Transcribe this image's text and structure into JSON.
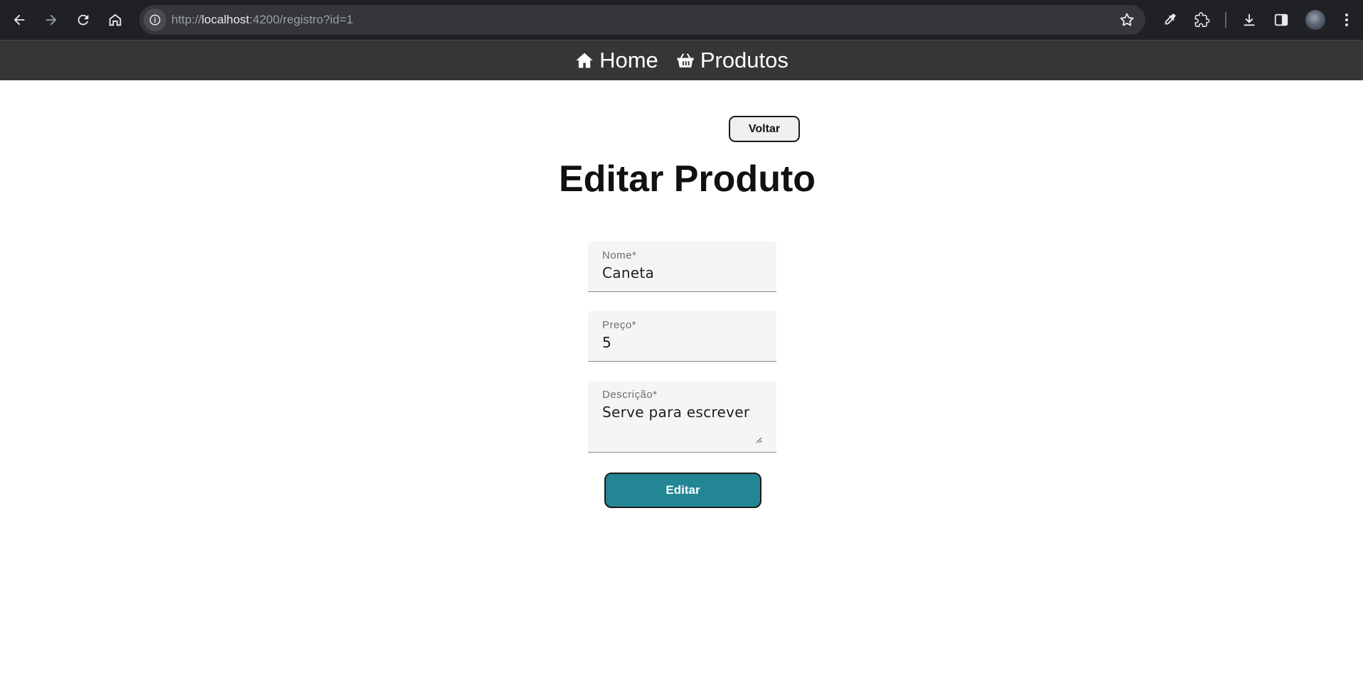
{
  "browser": {
    "url_scheme": "http://",
    "url_host": "localhost",
    "url_path": ":4200/registro?id=1"
  },
  "navbar": {
    "items": [
      {
        "label": "Home",
        "icon": "home-icon"
      },
      {
        "label": "Produtos",
        "icon": "basket-icon"
      }
    ]
  },
  "page": {
    "back_label": "Voltar",
    "title": "Editar Produto",
    "submit_label": "Editar"
  },
  "form": {
    "nome": {
      "label": "Nome*",
      "value": "Caneta"
    },
    "preco": {
      "label": "Preço*",
      "value": "5"
    },
    "descricao": {
      "label": "Descrição*",
      "value": "Serve para escrever"
    }
  },
  "colors": {
    "navbar_bg": "#363636",
    "primary_button": "#238695",
    "field_bg": "#f5f5f5"
  }
}
